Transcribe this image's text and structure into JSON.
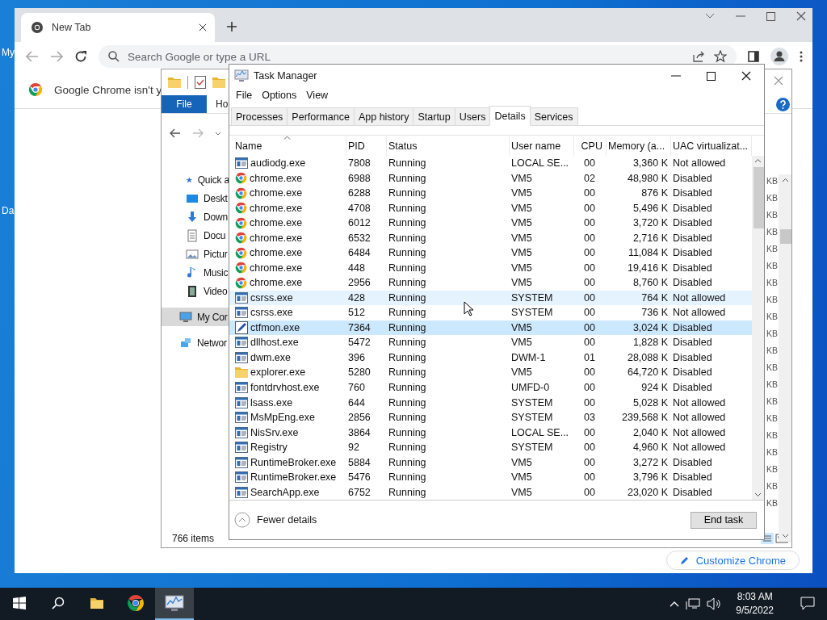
{
  "desktop": {
    "icon_labels": [
      "My",
      "Da"
    ]
  },
  "chrome": {
    "tab": {
      "title": "New Tab"
    },
    "address": {
      "placeholder": "Search Google or type a URL"
    },
    "infobar": {
      "text": "Google Chrome isn't y"
    },
    "customize_button": "Customize Chrome"
  },
  "explorer": {
    "ribbon_tabs": [
      {
        "label": "File",
        "selected": true
      },
      {
        "label": "Ho",
        "selected": false
      }
    ],
    "nav_items": [
      {
        "label": "Quick a",
        "kind": "star",
        "selected": false
      },
      {
        "label": "Deskt",
        "kind": "desktop",
        "selected": false
      },
      {
        "label": "Down",
        "kind": "download",
        "selected": false
      },
      {
        "label": "Docu",
        "kind": "document",
        "selected": false
      },
      {
        "label": "Pictur",
        "kind": "pictures",
        "selected": false
      },
      {
        "label": "Music",
        "kind": "music",
        "selected": false
      },
      {
        "label": "Video",
        "kind": "video",
        "selected": false
      },
      {
        "label": "My Cor",
        "kind": "computer",
        "selected": true
      },
      {
        "label": "Networ",
        "kind": "network",
        "selected": false
      }
    ],
    "sizes": [
      "KB",
      "KB",
      "KB",
      "KB",
      "KB",
      "KB",
      "KB",
      "KB",
      "KB",
      "KB",
      "KB",
      "KB",
      "KB",
      "KB",
      "KB",
      "KB",
      "KB",
      "KB",
      "KB",
      "KB"
    ],
    "status": "766 items"
  },
  "task_manager": {
    "title": "Task Manager",
    "menu": [
      "File",
      "Options",
      "View"
    ],
    "tabs": [
      {
        "label": "Processes",
        "selected": false
      },
      {
        "label": "Performance",
        "selected": false
      },
      {
        "label": "App history",
        "selected": false
      },
      {
        "label": "Startup",
        "selected": false
      },
      {
        "label": "Users",
        "selected": false
      },
      {
        "label": "Details",
        "selected": true
      },
      {
        "label": "Services",
        "selected": false
      }
    ],
    "columns": [
      "Name",
      "PID",
      "Status",
      "User name",
      "CPU",
      "Memory (a...",
      "UAC virtualizat..."
    ],
    "rows": [
      {
        "kind": "generic",
        "name": "audiodg.exe",
        "pid": "7808",
        "status": "Running",
        "user": "LOCAL SE...",
        "cpu": "00",
        "memory": "3,360 K",
        "uac": "Not allowed",
        "selected": false,
        "hovered": false
      },
      {
        "kind": "chrome",
        "name": "chrome.exe",
        "pid": "6988",
        "status": "Running",
        "user": "VM5",
        "cpu": "02",
        "memory": "48,980 K",
        "uac": "Disabled",
        "selected": false,
        "hovered": false
      },
      {
        "kind": "chrome",
        "name": "chrome.exe",
        "pid": "6288",
        "status": "Running",
        "user": "VM5",
        "cpu": "00",
        "memory": "876 K",
        "uac": "Disabled",
        "selected": false,
        "hovered": false
      },
      {
        "kind": "chrome",
        "name": "chrome.exe",
        "pid": "4708",
        "status": "Running",
        "user": "VM5",
        "cpu": "00",
        "memory": "5,496 K",
        "uac": "Disabled",
        "selected": false,
        "hovered": false
      },
      {
        "kind": "chrome",
        "name": "chrome.exe",
        "pid": "6012",
        "status": "Running",
        "user": "VM5",
        "cpu": "00",
        "memory": "3,720 K",
        "uac": "Disabled",
        "selected": false,
        "hovered": false
      },
      {
        "kind": "chrome",
        "name": "chrome.exe",
        "pid": "6532",
        "status": "Running",
        "user": "VM5",
        "cpu": "00",
        "memory": "2,716 K",
        "uac": "Disabled",
        "selected": false,
        "hovered": false
      },
      {
        "kind": "chrome",
        "name": "chrome.exe",
        "pid": "6484",
        "status": "Running",
        "user": "VM5",
        "cpu": "00",
        "memory": "11,084 K",
        "uac": "Disabled",
        "selected": false,
        "hovered": false
      },
      {
        "kind": "chrome",
        "name": "chrome.exe",
        "pid": "448",
        "status": "Running",
        "user": "VM5",
        "cpu": "00",
        "memory": "19,416 K",
        "uac": "Disabled",
        "selected": false,
        "hovered": false
      },
      {
        "kind": "chrome",
        "name": "chrome.exe",
        "pid": "2956",
        "status": "Running",
        "user": "VM5",
        "cpu": "00",
        "memory": "8,760 K",
        "uac": "Disabled",
        "selected": false,
        "hovered": false
      },
      {
        "kind": "generic",
        "name": "csrss.exe",
        "pid": "428",
        "status": "Running",
        "user": "SYSTEM",
        "cpu": "00",
        "memory": "764 K",
        "uac": "Not allowed",
        "selected": false,
        "hovered": true
      },
      {
        "kind": "generic",
        "name": "csrss.exe",
        "pid": "512",
        "status": "Running",
        "user": "SYSTEM",
        "cpu": "00",
        "memory": "736 K",
        "uac": "Not allowed",
        "selected": false,
        "hovered": false
      },
      {
        "kind": "pen",
        "name": "ctfmon.exe",
        "pid": "7364",
        "status": "Running",
        "user": "VM5",
        "cpu": "00",
        "memory": "3,024 K",
        "uac": "Disabled",
        "selected": true,
        "hovered": false
      },
      {
        "kind": "generic",
        "name": "dllhost.exe",
        "pid": "5472",
        "status": "Running",
        "user": "VM5",
        "cpu": "00",
        "memory": "1,828 K",
        "uac": "Disabled",
        "selected": false,
        "hovered": false
      },
      {
        "kind": "generic",
        "name": "dwm.exe",
        "pid": "396",
        "status": "Running",
        "user": "DWM-1",
        "cpu": "01",
        "memory": "28,088 K",
        "uac": "Disabled",
        "selected": false,
        "hovered": false
      },
      {
        "kind": "folder",
        "name": "explorer.exe",
        "pid": "5280",
        "status": "Running",
        "user": "VM5",
        "cpu": "00",
        "memory": "64,720 K",
        "uac": "Disabled",
        "selected": false,
        "hovered": false
      },
      {
        "kind": "generic",
        "name": "fontdrvhost.exe",
        "pid": "760",
        "status": "Running",
        "user": "UMFD-0",
        "cpu": "00",
        "memory": "924 K",
        "uac": "Disabled",
        "selected": false,
        "hovered": false
      },
      {
        "kind": "generic",
        "name": "lsass.exe",
        "pid": "644",
        "status": "Running",
        "user": "SYSTEM",
        "cpu": "00",
        "memory": "5,028 K",
        "uac": "Not allowed",
        "selected": false,
        "hovered": false
      },
      {
        "kind": "generic",
        "name": "MsMpEng.exe",
        "pid": "2856",
        "status": "Running",
        "user": "SYSTEM",
        "cpu": "03",
        "memory": "239,568 K",
        "uac": "Not allowed",
        "selected": false,
        "hovered": false
      },
      {
        "kind": "generic",
        "name": "NisSrv.exe",
        "pid": "3864",
        "status": "Running",
        "user": "LOCAL SE...",
        "cpu": "00",
        "memory": "2,040 K",
        "uac": "Not allowed",
        "selected": false,
        "hovered": false
      },
      {
        "kind": "generic",
        "name": "Registry",
        "pid": "92",
        "status": "Running",
        "user": "SYSTEM",
        "cpu": "00",
        "memory": "4,960 K",
        "uac": "Not allowed",
        "selected": false,
        "hovered": false
      },
      {
        "kind": "generic",
        "name": "RuntimeBroker.exe",
        "pid": "5884",
        "status": "Running",
        "user": "VM5",
        "cpu": "00",
        "memory": "3,272 K",
        "uac": "Disabled",
        "selected": false,
        "hovered": false
      },
      {
        "kind": "generic",
        "name": "RuntimeBroker.exe",
        "pid": "5476",
        "status": "Running",
        "user": "VM5",
        "cpu": "00",
        "memory": "3,796 K",
        "uac": "Disabled",
        "selected": false,
        "hovered": false
      },
      {
        "kind": "generic",
        "name": "SearchApp.exe",
        "pid": "6752",
        "status": "Running",
        "user": "VM5",
        "cpu": "00",
        "memory": "23,020 K",
        "uac": "Disabled",
        "selected": false,
        "hovered": false
      }
    ],
    "footer": {
      "fewer_details": "Fewer details",
      "end_task": "End task"
    }
  },
  "taskbar": {
    "apps": [
      {
        "kind": "explorer",
        "active": false
      },
      {
        "kind": "chrome",
        "active": false
      },
      {
        "kind": "taskmgr",
        "active": true
      }
    ],
    "time": "8:03 AM",
    "date": "9/5/2022"
  }
}
